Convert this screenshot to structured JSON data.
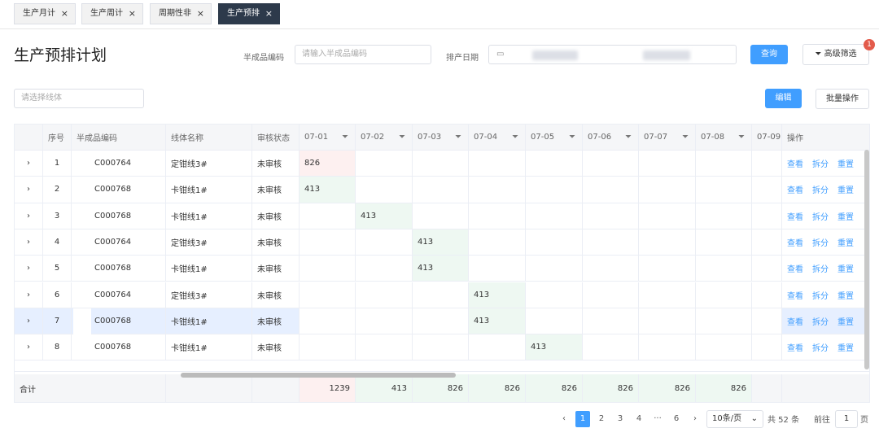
{
  "tabs": [
    {
      "label": "生产月计",
      "close": "×"
    },
    {
      "label": "生产周计",
      "close": "×"
    },
    {
      "label": "周期性非",
      "close": "×"
    },
    {
      "label": "生产预排",
      "close": "×"
    }
  ],
  "page_title": "生产预排计划",
  "filters": {
    "code_label": "半成品编码",
    "code_placeholder": "请输入半成品编码",
    "date_label": "排产日期",
    "line_placeholder": "请选择线体"
  },
  "buttons": {
    "query": "查询",
    "advanced": "高级筛选",
    "advanced_badge": "1",
    "edit": "编辑",
    "batch": "批量操作"
  },
  "table": {
    "headers": [
      "序号",
      "半成品编码",
      "线体名称",
      "审核状态",
      "07-01",
      "07-02",
      "07-03",
      "07-04",
      "07-05",
      "07-06",
      "07-07",
      "07-08",
      "07-09",
      "操作"
    ],
    "rows": [
      {
        "no": "1",
        "code": "\u000000764",
        "code_text": "C000764",
        "line": "定钳线3#",
        "status": "未审核",
        "day": 0,
        "qty": "826"
      },
      {
        "no": "2",
        "code_text": "C000768",
        "line": "卡钳线1#",
        "status": "未审核",
        "day": 0,
        "qty": "413"
      },
      {
        "no": "3",
        "code_text": "C000768",
        "line": "卡钳线1#",
        "status": "未审核",
        "day": 1,
        "qty": "413"
      },
      {
        "no": "4",
        "code_text": "C000764",
        "line": "定钳线3#",
        "status": "未审核",
        "day": 2,
        "qty": "413"
      },
      {
        "no": "5",
        "code_text": "C000768",
        "line": "卡钳线1#",
        "status": "未审核",
        "day": 2,
        "qty": "413"
      },
      {
        "no": "6",
        "code_text": "C000764",
        "line": "定钳线3#",
        "status": "未审核",
        "day": 3,
        "qty": "413"
      },
      {
        "no": "7",
        "code_text": "C000768",
        "line": "卡钳线1#",
        "status": "未审核",
        "day": 3,
        "qty": "413"
      },
      {
        "no": "8",
        "code_text": "C000768",
        "line": "卡钳线1#",
        "status": "未审核",
        "day": 4,
        "qty": "413"
      }
    ],
    "actions": [
      "查看",
      "拆分",
      "重置"
    ],
    "expand": "›",
    "total_label": "合计",
    "totals": [
      "1239",
      "413",
      "826",
      "826",
      "826",
      "826",
      "826",
      "826"
    ]
  },
  "pagination": {
    "prev": "‹",
    "pages": [
      "1",
      "2",
      "3",
      "4"
    ],
    "ellipsis": "···",
    "last": "6",
    "next": "›",
    "page_size": "10条/页",
    "total": "共 52 条",
    "goto_label": "前往",
    "goto_value": "1",
    "goto_unit": "页"
  },
  "colors": {
    "primary": "#409eff",
    "tab_active": "#2d3a4b",
    "badge": "#e35b4b",
    "red_bg": "#fdf0f0",
    "green_bg": "#eef8f2",
    "selected": "#e6efff"
  }
}
